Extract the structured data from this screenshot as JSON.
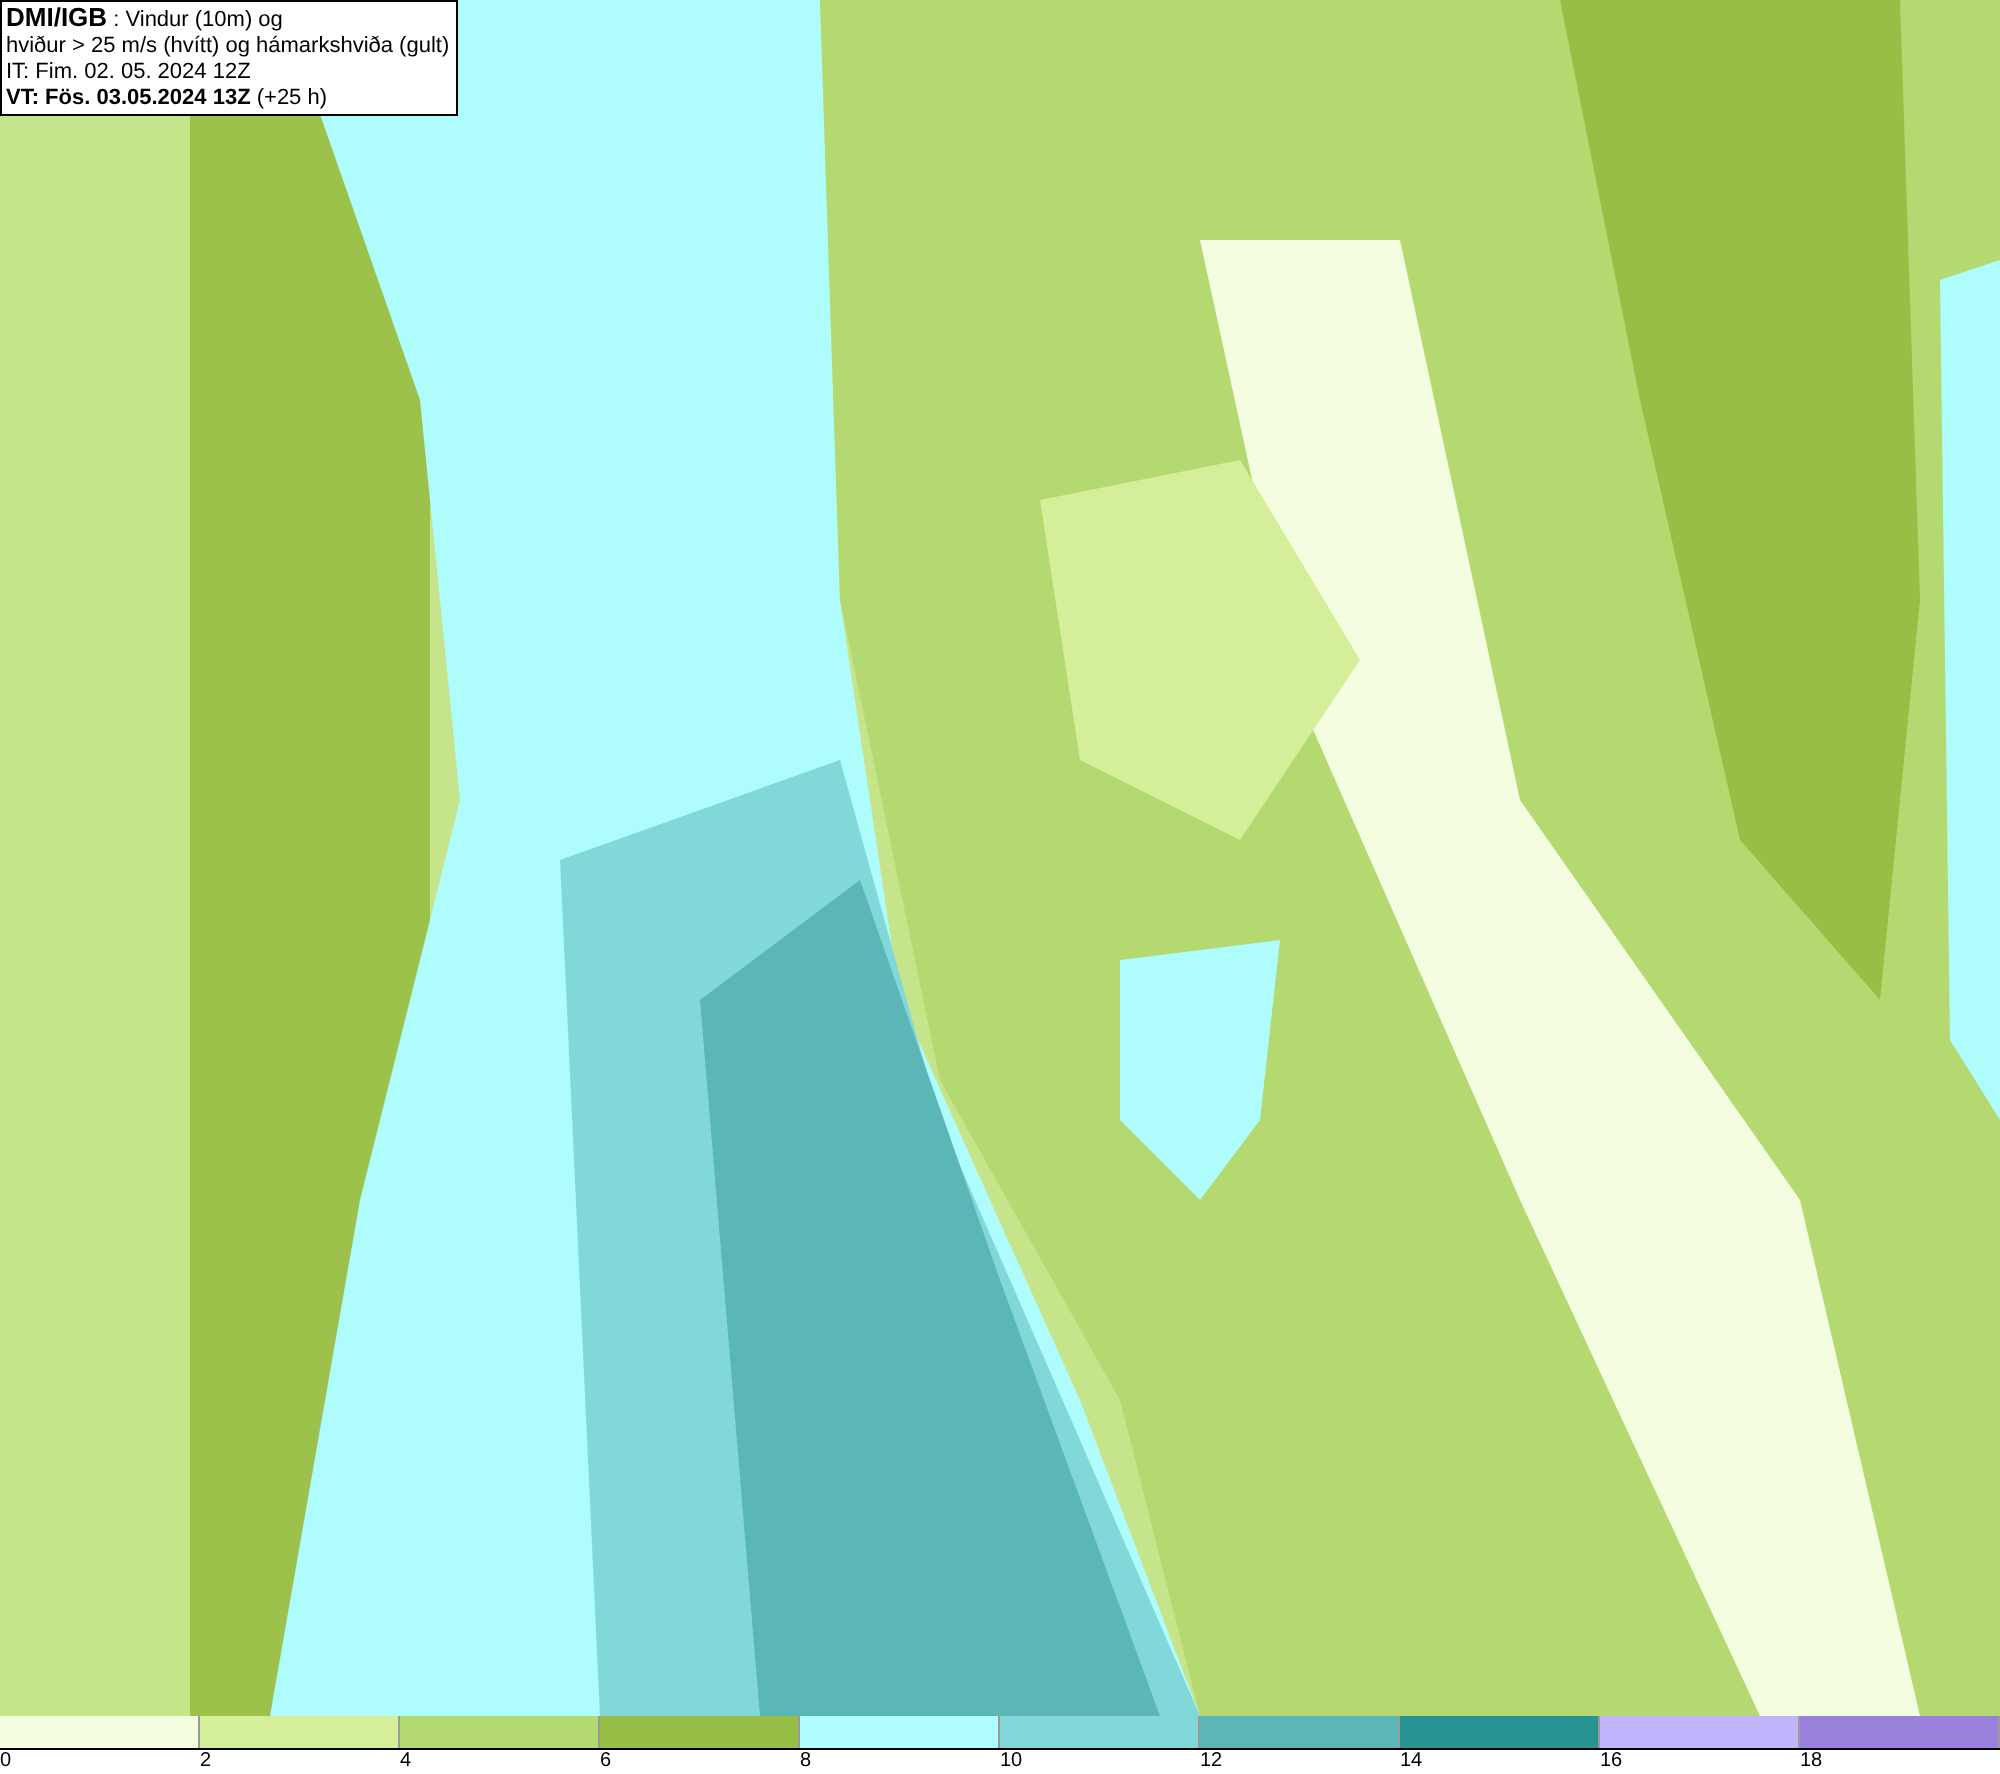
{
  "header": {
    "source": "DMI/IGB",
    "title_rest": " : Vindur (10m) og",
    "line_2": "hviður > 25 m/s (hvítt) og hámarkshviða (gult)",
    "line_3": "IT: Fim. 02. 05. 2024 12Z",
    "valid_bold": "VT: Fös. 03.05.2024 13Z",
    "valid_rest": " (+25 h)"
  },
  "legend": {
    "swatches": [
      {
        "color": "#f5fde0"
      },
      {
        "color": "#d4ee9a"
      },
      {
        "color": "#b4d970"
      },
      {
        "color": "#97bf45"
      },
      {
        "color": "#aefcfc"
      },
      {
        "color": "#82d8d8"
      },
      {
        "color": "#5bb6b6"
      },
      {
        "color": "#279393"
      },
      {
        "color": "#c1b4fa"
      },
      {
        "color": "#9a82dc"
      }
    ],
    "labels": [
      "0",
      "2",
      "4",
      "6",
      "8",
      "10",
      "12",
      "14",
      "16",
      "18"
    ]
  }
}
